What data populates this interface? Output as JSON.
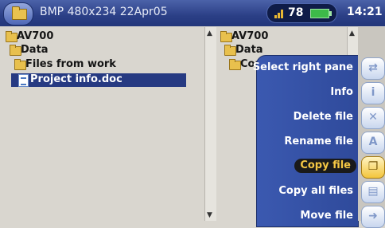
{
  "titlebar": {
    "title": "BMP 480x234 22Apr05",
    "level": "78",
    "time": "14:21"
  },
  "left_pane": {
    "items": [
      {
        "label": "AV700",
        "icon": "folder-icon"
      },
      {
        "label": "Data",
        "icon": "folder-icon"
      },
      {
        "label": "Files from work",
        "icon": "folder-icon"
      },
      {
        "label": "Project info.doc",
        "icon": "document-icon"
      }
    ]
  },
  "right_pane": {
    "items": [
      {
        "label": "AV700",
        "icon": "folder-icon"
      },
      {
        "label": "Data",
        "icon": "folder-icon"
      },
      {
        "label": "Con",
        "icon": "folder-icon"
      }
    ]
  },
  "menu": {
    "items": [
      {
        "label": "Select right pane",
        "icon": "pane-switch-icon"
      },
      {
        "label": "Info",
        "icon": "info-icon"
      },
      {
        "label": "Delete file",
        "icon": "delete-icon"
      },
      {
        "label": "Rename file",
        "icon": "rename-icon"
      },
      {
        "label": "Copy file",
        "icon": "copy-icon"
      },
      {
        "label": "Copy all files",
        "icon": "copy-all-icon"
      },
      {
        "label": "Move file",
        "icon": "move-icon"
      }
    ],
    "selected": "Copy file"
  },
  "colors": {
    "titlebar": "#2b3f86",
    "selection": "#263a82",
    "menu": "#3b59b0",
    "active_text": "#f5c744"
  }
}
